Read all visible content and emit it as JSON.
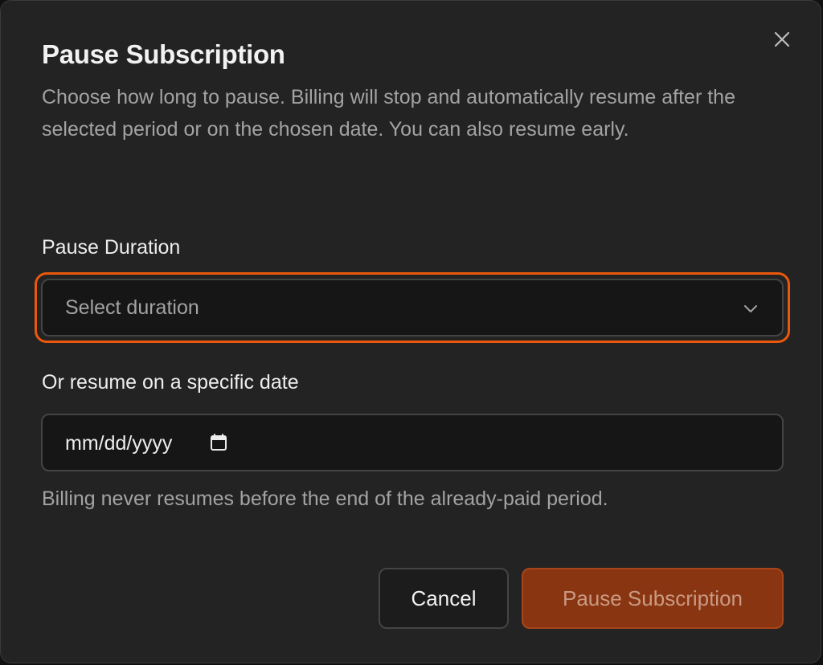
{
  "dialog": {
    "title": "Pause Subscription",
    "description": "Choose how long to pause. Billing will stop and automatically resume after the selected period or on the chosen date. You can also resume early.",
    "close_icon": "close-icon"
  },
  "duration": {
    "label": "Pause Duration",
    "placeholder": "Select duration",
    "icon": "chevron-down-icon",
    "focused": true,
    "focus_color": "#ea580c"
  },
  "resume_date": {
    "label": "Or resume on a specific date",
    "placeholder": "mm/dd/yyyy",
    "icon": "calendar-icon"
  },
  "helper_text": "Billing never resumes before the end of the already-paid period.",
  "actions": {
    "cancel_label": "Cancel",
    "confirm_label": "Pause Subscription",
    "confirm_disabled": true
  },
  "colors": {
    "dialog_bg": "#232323",
    "accent": "#ea580c",
    "primary_button_bg": "#8a3512"
  }
}
